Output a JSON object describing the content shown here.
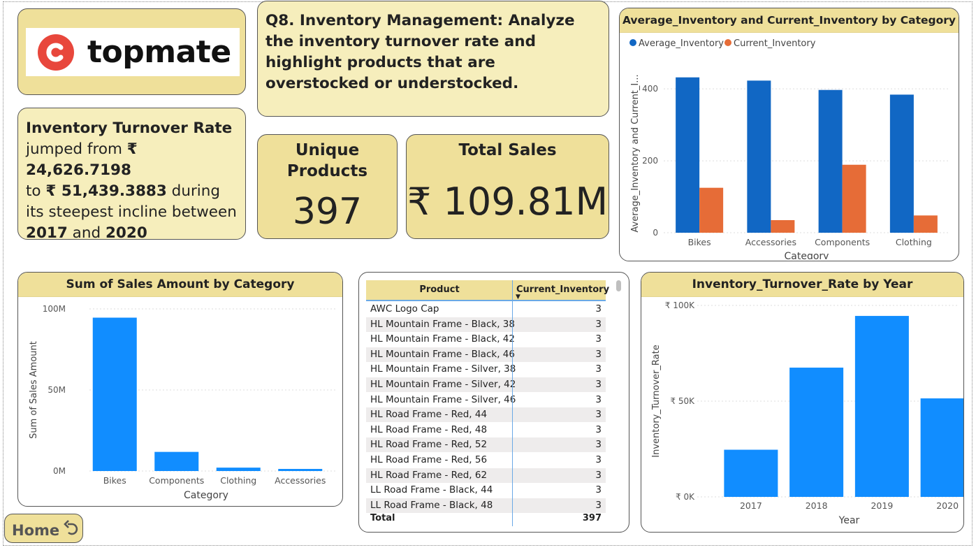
{
  "logo": {
    "text": "topmate"
  },
  "question": {
    "text": "Q8. Inventory Management: Analyze the inventory turnover rate and highlight products that are overstocked or understocked."
  },
  "insight": {
    "heading": "Inventory Turnover Rate",
    "p1": "jumped from ",
    "from_value": "₹ 24,626.7198",
    "p2": "to ",
    "to_value": "₹ 51,439.3883",
    "p3": " during its steepest incline between ",
    "year_start": "2017",
    "p4": " and ",
    "year_end": "2020"
  },
  "kpi_products": {
    "title_line1": "Unique",
    "title_line2": "Products",
    "value": "397"
  },
  "kpi_sales": {
    "title": "Total Sales",
    "value": "₹ 109.81M"
  },
  "table": {
    "headers": [
      "Product",
      "Current_Inventory"
    ],
    "rows": [
      [
        "AWC Logo Cap",
        "3"
      ],
      [
        "HL Mountain Frame - Black, 38",
        "3"
      ],
      [
        "HL Mountain Frame - Black, 42",
        "3"
      ],
      [
        "HL Mountain Frame - Black, 46",
        "3"
      ],
      [
        "HL Mountain Frame - Silver, 38",
        "3"
      ],
      [
        "HL Mountain Frame - Silver, 42",
        "3"
      ],
      [
        "HL Mountain Frame - Silver, 46",
        "3"
      ],
      [
        "HL Road Frame - Red, 44",
        "3"
      ],
      [
        "HL Road Frame - Red, 48",
        "3"
      ],
      [
        "HL Road Frame - Red, 52",
        "3"
      ],
      [
        "HL Road Frame - Red, 56",
        "3"
      ],
      [
        "HL Road Frame - Red, 62",
        "3"
      ],
      [
        "LL Road Frame - Black, 44",
        "3"
      ],
      [
        "LL Road Frame - Black, 48",
        "3"
      ]
    ],
    "total_label": "Total",
    "total_value": "397"
  },
  "home_button": {
    "label": "Home"
  },
  "colors": {
    "card_tan": "#efe09a",
    "card_light": "#f6eebc",
    "bar_blue": "#118dff",
    "bar_darkblue": "#1167c4",
    "bar_orange": "#e66c37",
    "logo_red": "#e8473c"
  },
  "chart_data": [
    {
      "type": "bar",
      "title": "Average_Inventory and Current_Inventory by Category",
      "xlabel": "Category",
      "ylabel": "Average_Inventory and Current_I...",
      "categories": [
        "Bikes",
        "Accessories",
        "Components",
        "Clothing"
      ],
      "series": [
        {
          "name": "Average_Inventory",
          "values": [
            432,
            423,
            397,
            384
          ],
          "color": "#1167c4"
        },
        {
          "name": "Current_Inventory",
          "values": [
            125,
            35,
            189,
            48
          ],
          "color": "#e66c37"
        }
      ],
      "yticks": [
        0,
        200,
        400
      ],
      "ylim": [
        0,
        480
      ],
      "legend": "top-left",
      "grid": true
    },
    {
      "type": "bar",
      "title": "Sum of Sales Amount by Category",
      "xlabel": "Category",
      "ylabel": "Sum of Sales Amount",
      "categories": [
        "Bikes",
        "Components",
        "Clothing",
        "Accessories"
      ],
      "values": [
        94.6,
        11.8,
        2.1,
        1.3
      ],
      "unit": "M",
      "yticks": [
        "0M",
        "50M",
        "100M"
      ],
      "ylim": [
        0,
        100
      ],
      "grid": true
    },
    {
      "type": "bar",
      "title": "Inventory_Turnover_Rate by Year",
      "xlabel": "Year",
      "ylabel": "Inventory_Turnover_Rate",
      "categories": [
        "2017",
        "2018",
        "2019",
        "2020"
      ],
      "values": [
        24626.7198,
        67500,
        94500,
        51439.3883
      ],
      "yticks": [
        "₹ 0K",
        "₹ 50K",
        "₹ 100K"
      ],
      "ylim": [
        0,
        100000
      ],
      "grid": true
    }
  ]
}
